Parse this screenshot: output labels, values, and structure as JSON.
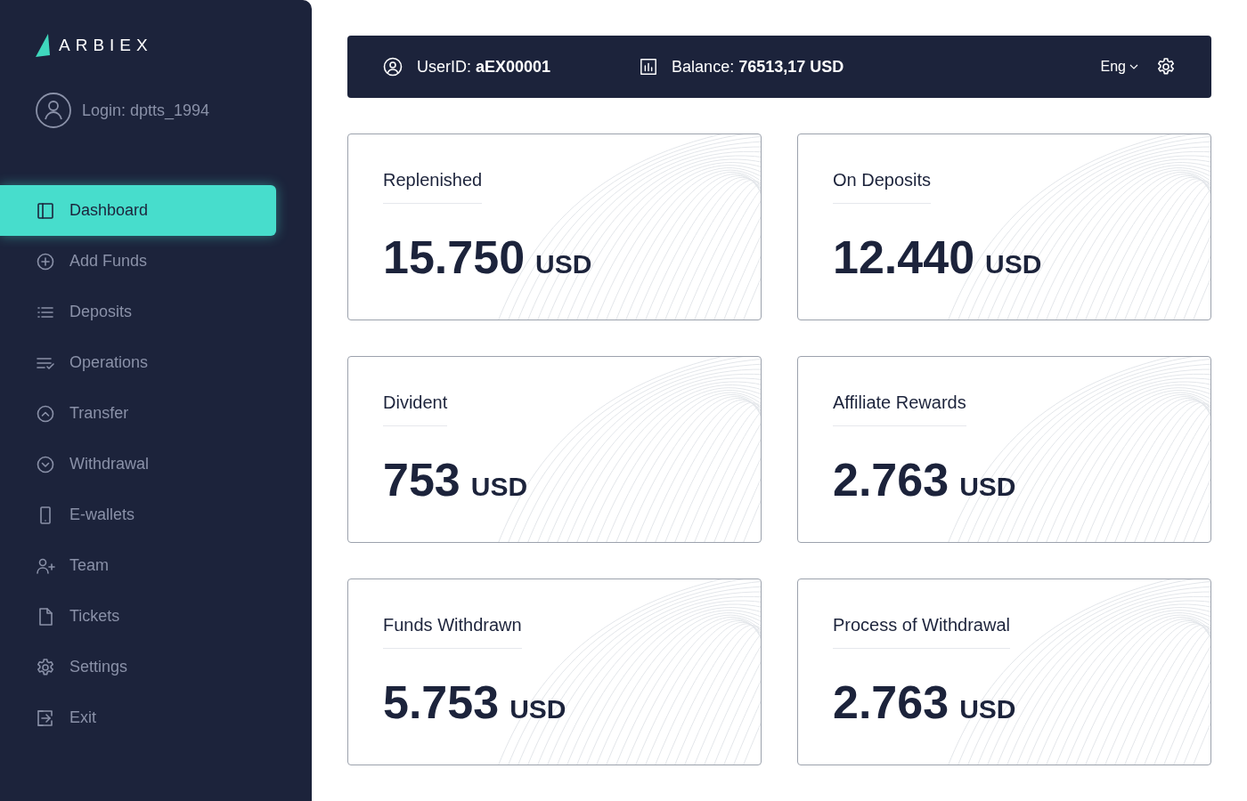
{
  "sidebar": {
    "logo": "ARBIEX",
    "login": "Login: dptts_1994",
    "items": [
      {
        "label": "Dashboard",
        "selected": true
      },
      {
        "label": "Add Funds",
        "selected": false
      },
      {
        "label": "Deposits",
        "selected": false
      },
      {
        "label": "Operations",
        "selected": false
      },
      {
        "label": "Transfer",
        "selected": false
      },
      {
        "label": "Withdrawal",
        "selected": false
      },
      {
        "label": "E-wallets",
        "selected": false
      },
      {
        "label": "Team",
        "selected": false
      },
      {
        "label": "Tickets",
        "selected": false
      },
      {
        "label": "Settings",
        "selected": false
      },
      {
        "label": "Exit",
        "selected": false
      }
    ]
  },
  "top_bar": {
    "user_id": "UserID: **aEX00001**",
    "balance": "Balance: **76513,17 USD**",
    "language": "Eng"
  },
  "cards": [
    {
      "title": "Replenished",
      "amount": "15.750",
      "unit": "USD"
    },
    {
      "title": "On Deposits",
      "amount": "12.440",
      "unit": "USD"
    },
    {
      "title": "Divident",
      "amount": "753",
      "unit": "USD"
    },
    {
      "title": "Affiliate Rewards",
      "amount": "2.763",
      "unit": "USD"
    },
    {
      "title": "Funds Withdrawn",
      "amount": "5.753",
      "unit": "USD"
    },
    {
      "title": "Process of Withdrawal",
      "amount": "2.763",
      "unit": "USD"
    }
  ]
}
